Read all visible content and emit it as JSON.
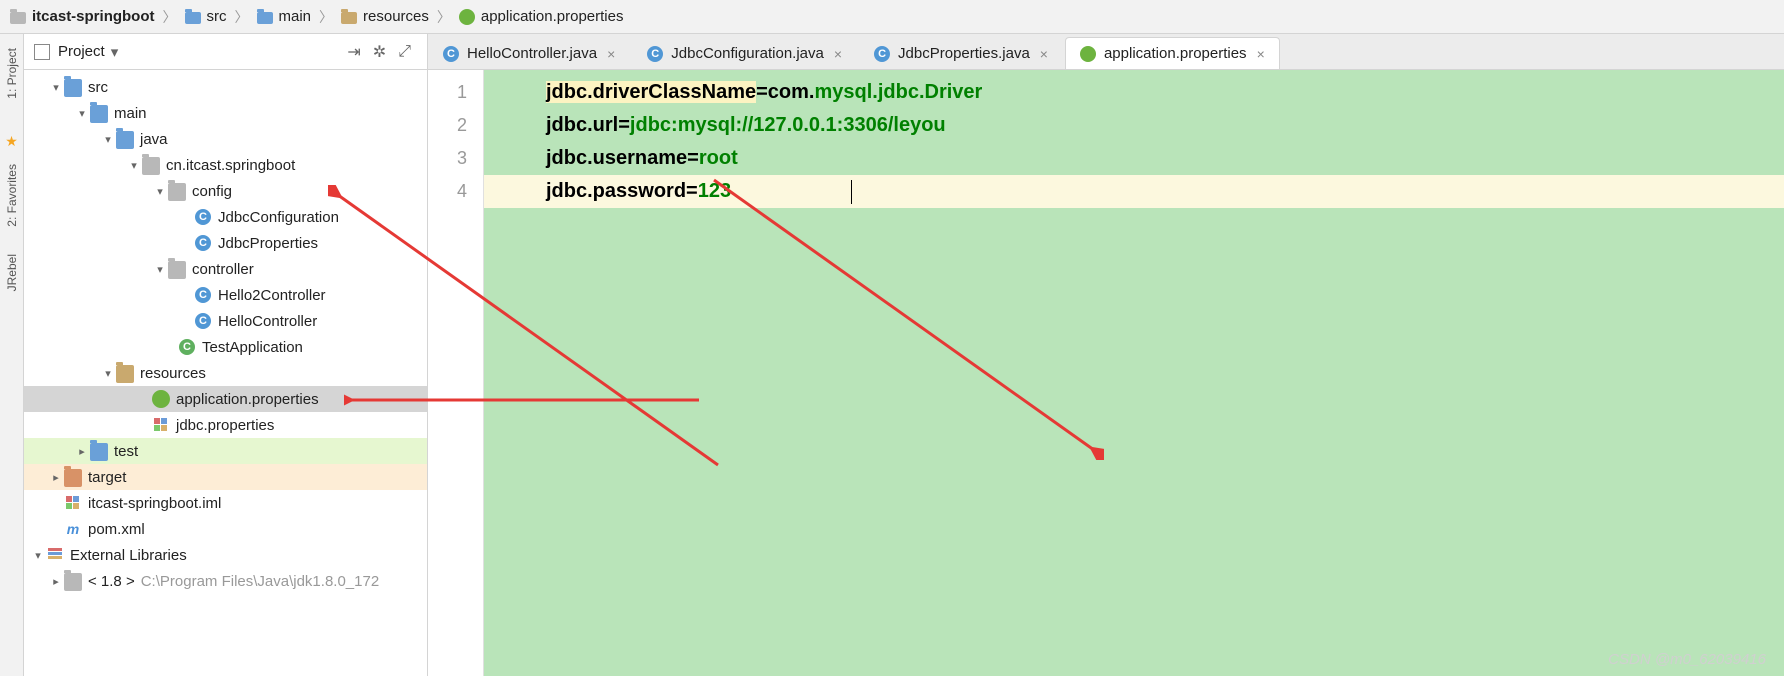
{
  "breadcrumb": {
    "project": "itcast-springboot",
    "src": "src",
    "main": "main",
    "resources": "resources",
    "file": "application.properties"
  },
  "leftRail": {
    "project": "1: Project",
    "favorites": "2: Favorites",
    "jrebel": "JRebel"
  },
  "panel": {
    "title": "Project"
  },
  "tree": {
    "src": "src",
    "main": "main",
    "java": "java",
    "pkg": "cn.itcast.springboot",
    "config": "config",
    "jdbcConfig": "JdbcConfiguration",
    "jdbcProps": "JdbcProperties",
    "controller": "controller",
    "hello2": "Hello2Controller",
    "hello": "HelloController",
    "testApp": "TestApplication",
    "resources": "resources",
    "appProps": "application.properties",
    "jdbcPropsFile": "jdbc.properties",
    "test": "test",
    "target": "target",
    "iml": "itcast-springboot.iml",
    "pom": "pom.xml",
    "extLib": "External Libraries",
    "jdk": "< 1.8 >",
    "jdkPath": "C:\\Program Files\\Java\\jdk1.8.0_172"
  },
  "tabs": {
    "helloController": "HelloController.java",
    "jdbcConfig": "JdbcConfiguration.java",
    "jdbcProps": "JdbcProperties.java",
    "appProps": "application.properties"
  },
  "code": {
    "l1_key": "jdbc.driverClassName",
    "l1_eq": "=",
    "l1_v1": "com.",
    "l1_v2": "mysql.jdbc.Driver",
    "l2_key": "jdbc.url",
    "l2_eq": "=",
    "l2_val": "jdbc:mysql://127.0.0.1:3306/leyou",
    "l3_key": "jdbc.username",
    "l3_eq": "=",
    "l3_val": "root",
    "l4_key": "jdbc.password",
    "l4_eq": "=",
    "l4_val": "123",
    "ln1": "1",
    "ln2": "2",
    "ln3": "3",
    "ln4": "4"
  },
  "watermark": "CSDN @m0_62039416"
}
